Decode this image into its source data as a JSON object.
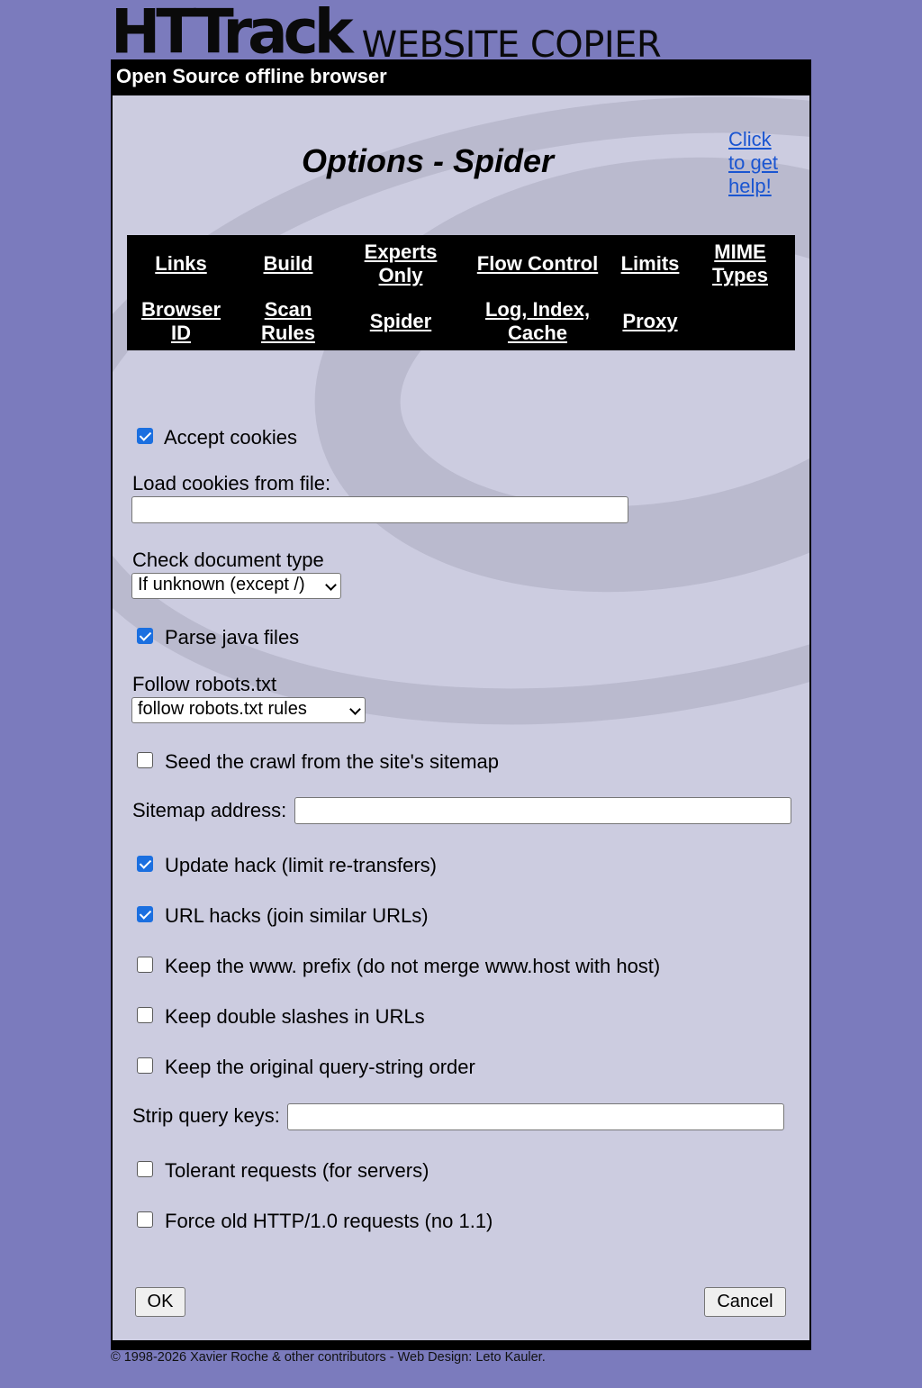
{
  "brand": {
    "logo_main": "HTTrack",
    "logo_sub": "WEBSITE COPIER",
    "subtitle": "Open Source offline browser"
  },
  "page": {
    "title": "Options - Spider",
    "help_link": "Click to get help!"
  },
  "nav": {
    "links": "Links",
    "build": "Build",
    "experts": "Experts Only",
    "flow": "Flow Control",
    "limits": "Limits",
    "mime": "MIME Types",
    "browser": "Browser ID",
    "scan": "Scan Rules",
    "spider": "Spider",
    "log": "Log, Index, Cache",
    "proxy": "Proxy"
  },
  "form": {
    "accept_cookies": {
      "label": "Accept cookies",
      "checked": true
    },
    "load_cookies": {
      "label": "Load cookies from file:",
      "value": ""
    },
    "check_doc_type": {
      "label": "Check document type",
      "selected": "If unknown (except /)"
    },
    "parse_java": {
      "label": "Parse java files",
      "checked": true
    },
    "robots": {
      "label": "Follow robots.txt",
      "selected": "follow robots.txt rules"
    },
    "sitemap_seed": {
      "label": "Seed the crawl from the site's sitemap",
      "checked": false
    },
    "sitemap_address": {
      "label": "Sitemap address:",
      "value": ""
    },
    "update_hack": {
      "label": "Update hack (limit re-transfers)",
      "checked": true
    },
    "url_hacks": {
      "label": "URL hacks (join similar URLs)",
      "checked": true
    },
    "keep_www": {
      "label": "Keep the www. prefix (do not merge www.host with host)",
      "checked": false
    },
    "keep_slashes": {
      "label": "Keep double slashes in URLs",
      "checked": false
    },
    "keep_query_order": {
      "label": "Keep the original query-string order",
      "checked": false
    },
    "strip_query": {
      "label": "Strip query keys:",
      "value": ""
    },
    "tolerant": {
      "label": "Tolerant requests (for servers)",
      "checked": false
    },
    "force_http10": {
      "label": "Force old HTTP/1.0 requests (no 1.1)",
      "checked": false
    }
  },
  "buttons": {
    "ok": "OK",
    "cancel": "Cancel"
  },
  "footer": {
    "text": "© 1998-2026 Xavier Roche & other contributors - Web Design: Leto Kauler."
  },
  "colors": {
    "background": "#7b7bbd",
    "panel": "#cccce0",
    "link": "#1a55d1",
    "checkbox": "#1b6fe0"
  }
}
